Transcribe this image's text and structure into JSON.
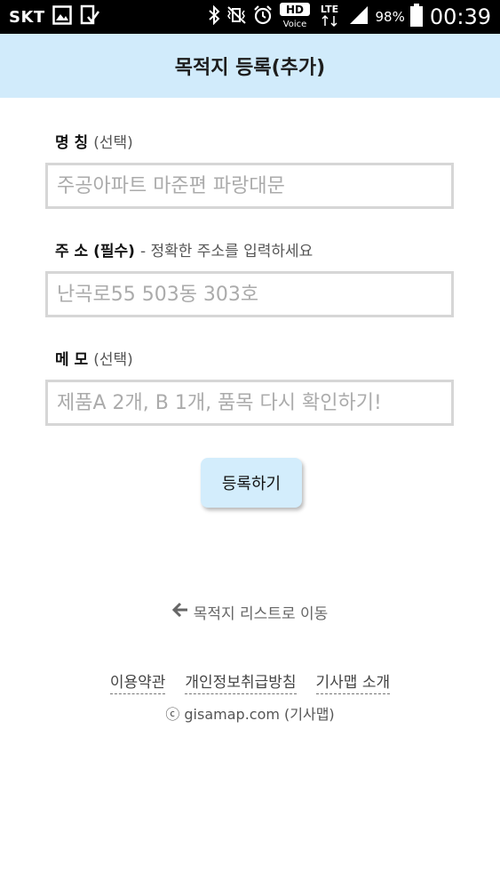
{
  "status_bar": {
    "carrier": "SKT",
    "battery": "98%",
    "time": "00:39",
    "network": "LTE",
    "hd_label": "HD",
    "voice_label": "Voice"
  },
  "header": {
    "title": "목적지 등록(추가)"
  },
  "form": {
    "name": {
      "label": "명 칭",
      "optional": "(선택)",
      "placeholder": "주공아파트 마준편 파랑대문"
    },
    "address": {
      "label": "주 소 (필수)",
      "hint": "- 정확한 주소를 입력하세요",
      "placeholder": "난곡로55 503동 303호"
    },
    "memo": {
      "label": "메 모",
      "optional": "(선택)",
      "placeholder": "제품A 2개, B 1개, 품목 다시 확인하기!"
    },
    "submit_label": "등록하기"
  },
  "back_link": {
    "label": "목적지 리스트로 이동"
  },
  "footer": {
    "links": [
      "이용약관",
      "개인정보취급방침",
      "기사맵 소개"
    ],
    "copyright": "ⓒ gisamap.com (기사맵)"
  },
  "colors": {
    "header_bg": "#d1ebfb",
    "button_bg": "#d3edfc",
    "input_border": "#d6d6d6"
  }
}
